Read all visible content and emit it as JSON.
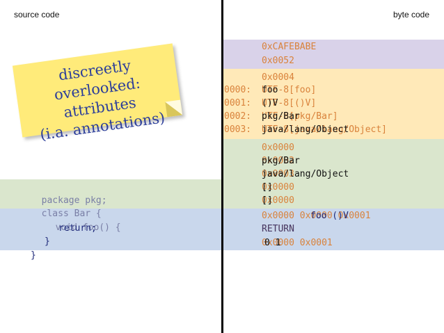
{
  "headers": {
    "left": "source code",
    "right": "byte code"
  },
  "sticky_note": {
    "lines": [
      "discreetly overlooked:",
      "attributes",
      "(i.a. annotations)"
    ]
  },
  "bytecode": {
    "magic": "0xCAFEBABE",
    "version": "0x0052",
    "pool_count": "0x0004",
    "pool_indices": [
      "0000:",
      "0001:",
      "0002:",
      "0003:"
    ],
    "pool_raw": [
      "UTF-8[foo]",
      "UTF-8[()V]",
      "UTF-8[pkg/Bar]",
      "UTF-8[java/lang/Object]"
    ],
    "pool_decoded": [
      "foo",
      "()V",
      "pkg/Bar",
      "java/lang/Object"
    ],
    "class_raw": [
      "0x0000",
      "0x0002",
      "0x0003",
      "0x0000",
      "0x0000"
    ],
    "class_decoded": [
      "pkg/Bar",
      "java/lang/Object",
      "[]",
      "[]"
    ],
    "method_raw": "0x0000 0x0000 0x0001",
    "method_decoded": "foo ()V",
    "method_body_raw": "RETURN",
    "method_body_decoded": "0x0000 0x0001",
    "method_tail": "0 1"
  },
  "source": {
    "line1_kw": "package",
    "line1_rest": " pkg;",
    "line2_kw": "class",
    "line2_rest": " Bar {",
    "line3_kw": "void",
    "line3_rest": " foo() {",
    "line4": "return;",
    "line5": "}",
    "line6": "}"
  },
  "colors": {
    "band_header": "#d9d2e9",
    "band_pool": "#ffe9b8",
    "band_class": "#dae6cd",
    "band_method": "#c9d7ec",
    "accent_orange": "#d9823b",
    "note_yellow": "#ffeb7a",
    "note_text": "#2c3e9a"
  }
}
